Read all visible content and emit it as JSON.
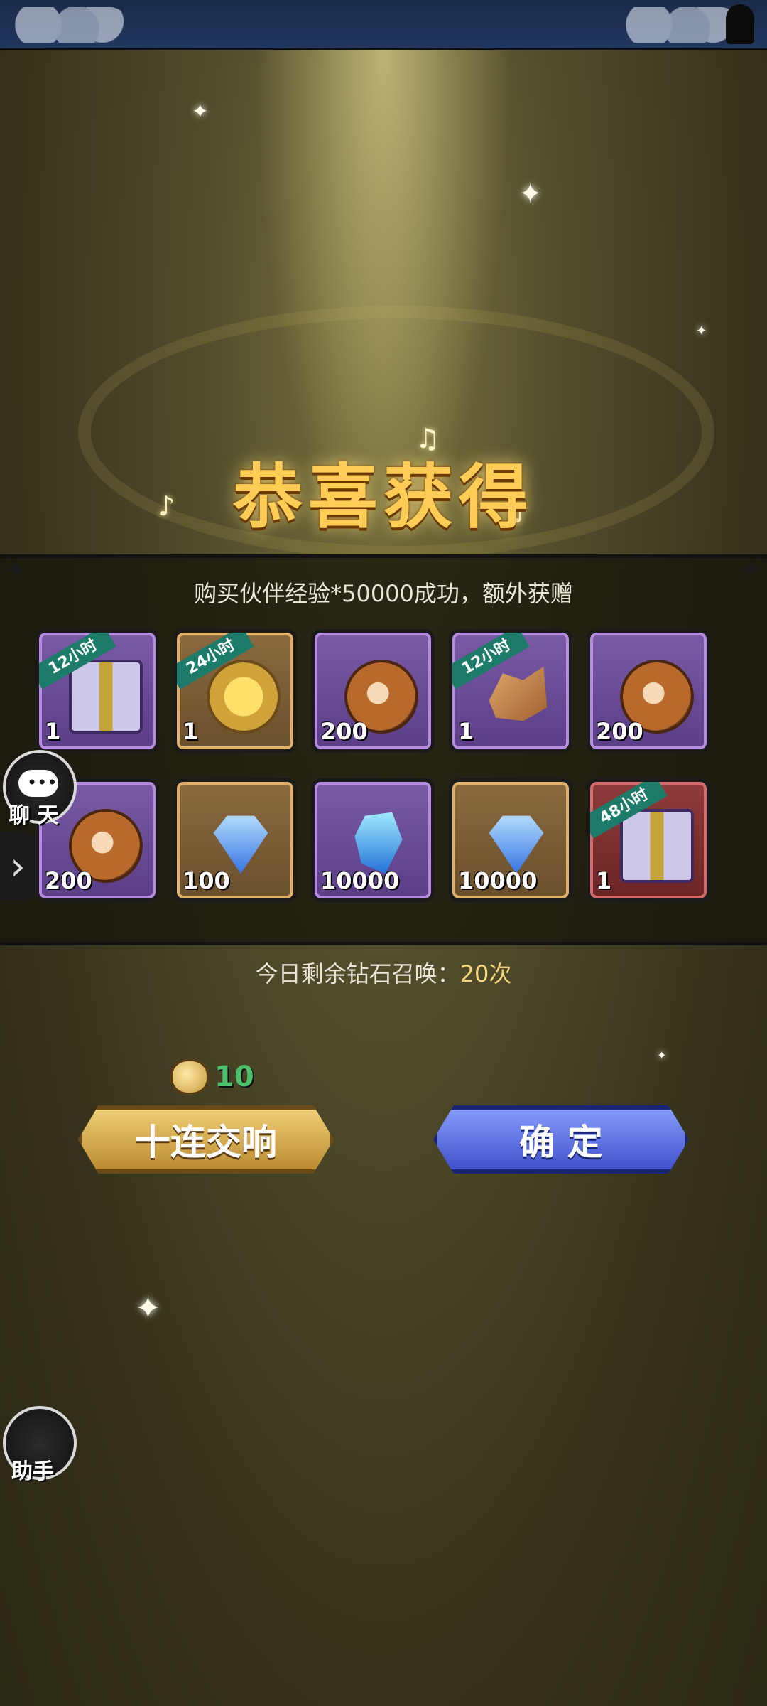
{
  "title": "恭喜获得",
  "subtitle": "购买伙伴经验*50000成功，额外获赠",
  "rewards": [
    {
      "ribbon": "12小时",
      "qty": "1",
      "frame": "purple",
      "icon": "exp-gift-box-icon"
    },
    {
      "ribbon": "24小时",
      "qty": "1",
      "frame": "gold",
      "icon": "gold-coins-icon"
    },
    {
      "ribbon": "",
      "qty": "200",
      "frame": "purple",
      "icon": "swirl-orb-icon"
    },
    {
      "ribbon": "12小时",
      "qty": "1",
      "frame": "purple",
      "icon": "rose-ore-icon"
    },
    {
      "ribbon": "",
      "qty": "200",
      "frame": "purple",
      "icon": "swirl-orb-icon"
    },
    {
      "ribbon": "",
      "qty": "200",
      "frame": "purple",
      "icon": "swirl-orb-icon"
    },
    {
      "ribbon": "",
      "qty": "100",
      "frame": "gold",
      "icon": "diamond-icon"
    },
    {
      "ribbon": "",
      "qty": "10000",
      "frame": "purple",
      "icon": "blue-crystal-icon"
    },
    {
      "ribbon": "",
      "qty": "10000",
      "frame": "gold",
      "icon": "diamond-icon"
    },
    {
      "ribbon": "48小时",
      "qty": "1",
      "frame": "red",
      "icon": "exp-gift-box-icon"
    }
  ],
  "summon_label": "今日剩余钻石召唤：",
  "summon_count": "20次",
  "cost": "10",
  "buttons": {
    "ten_pull": "十连交响",
    "confirm": "确 定"
  },
  "side": {
    "chat_label": "聊 天",
    "chat_icon_text": "•••",
    "helper_label": "助手",
    "expand_glyph": "›"
  }
}
